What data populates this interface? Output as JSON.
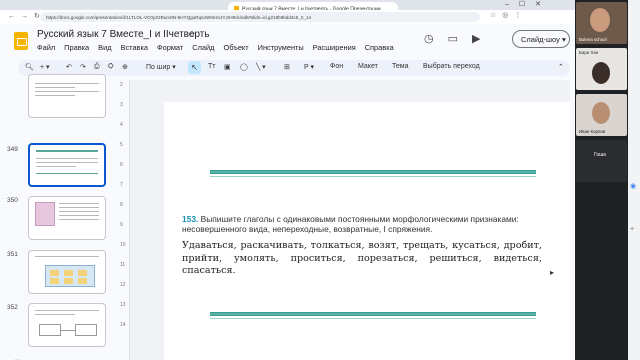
{
  "browser": {
    "tab_title": "Русский язык 7 Вместе_I и IIчетверть - Google Презентации",
    "url": "https://docs.google.com/presentation/d/1LTLOL-VC0yZ3Rurv8N-9HYQguRqsoWtnHnJYJrH9ck/edit#slide=id.g219b9bdd3c5_0_14"
  },
  "app": {
    "doc_title": "Русский язык 7 Вместе_I и IIчетверть",
    "menu": [
      "Файл",
      "Правка",
      "Вид",
      "Вставка",
      "Формат",
      "Слайд",
      "Объект",
      "Инструменты",
      "Расширения",
      "Справка"
    ],
    "slideshow_label": "Слайд-шоу",
    "accent": "#0b57d0"
  },
  "toolbar": {
    "zoom_label": "По шир",
    "background_label": "Фон",
    "layout_label": "Макет",
    "theme_label": "Тема",
    "transition_label": "Выбрать переход"
  },
  "filmstrip": {
    "slides": [
      {
        "number": "",
        "selected": false
      },
      {
        "number": "349",
        "selected": true
      },
      {
        "number": "350",
        "selected": false
      },
      {
        "number": "351",
        "selected": false
      },
      {
        "number": "352",
        "selected": false
      }
    ]
  },
  "ruler": [
    "2",
    "3",
    "4",
    "5",
    "6",
    "7",
    "8",
    "9",
    "10",
    "11",
    "12",
    "13",
    "14"
  ],
  "slide": {
    "task_number": "153.",
    "task_text": "Выпишите глаголы с одинаковыми постоянными морфологическими признаками: несовершенного вида, непереходные, возвратные, I спряжения.",
    "words": "Удаваться, раскачивать, толкаться, возят, трещать, кусаться, дробит, прийти, умолять, проситься, порезаться, решиться, видеться, спасаться."
  },
  "participants": [
    {
      "name": "Bulena school"
    },
    {
      "name": "Бари Хан"
    },
    {
      "name": "Иван Корпов"
    },
    {
      "name": "Гоша"
    },
    {
      "name": ""
    }
  ]
}
